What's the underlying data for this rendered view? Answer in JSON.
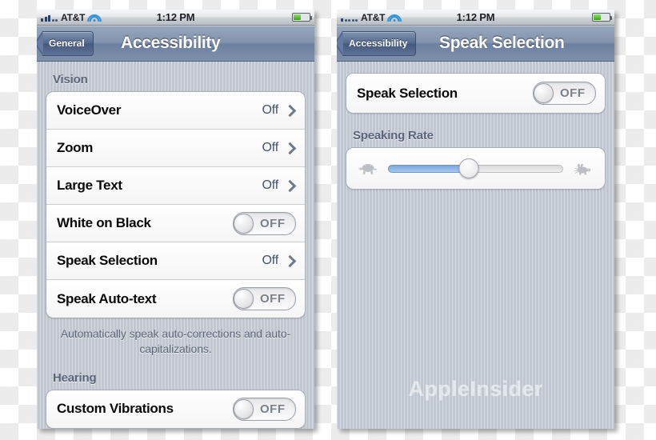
{
  "background": {
    "type": "transparency-checkerboard",
    "light": "#ffffff",
    "dark": "#ececec"
  },
  "left_phone": {
    "status_bar": {
      "carrier": "AT&T",
      "time": "1:12 PM",
      "signal_bars_filled": 3,
      "signal_bars_total": 5,
      "wifi": true,
      "battery_percent": 48
    },
    "nav": {
      "back_label": "General",
      "title": "Accessibility"
    },
    "sections": [
      {
        "header": "Vision",
        "rows": [
          {
            "label": "VoiceOver",
            "value": "Off",
            "control": "disclosure"
          },
          {
            "label": "Zoom",
            "value": "Off",
            "control": "disclosure"
          },
          {
            "label": "Large Text",
            "value": "Off",
            "control": "disclosure"
          },
          {
            "label": "White on Black",
            "value": "OFF",
            "control": "switch"
          },
          {
            "label": "Speak Selection",
            "value": "Off",
            "control": "disclosure"
          },
          {
            "label": "Speak Auto-text",
            "value": "OFF",
            "control": "switch"
          }
        ],
        "footnote": "Automatically speak auto-corrections and auto-capitalizations."
      },
      {
        "header": "Hearing",
        "rows": [
          {
            "label": "Custom Vibrations",
            "value": "OFF",
            "control": "switch"
          }
        ],
        "footnote": ""
      }
    ]
  },
  "right_phone": {
    "status_bar": {
      "carrier": "AT&T",
      "time": "1:12 PM",
      "signal_bars_filled": 1,
      "signal_bars_total": 5,
      "wifi": true,
      "battery_percent": 48
    },
    "nav": {
      "back_label": "Accessibility",
      "title": "Speak Selection"
    },
    "toggle_row": {
      "label": "Speak Selection",
      "value": "OFF"
    },
    "rate_section": {
      "header": "Speaking Rate",
      "slider": {
        "value_percent": 46,
        "min_icon": "tortoise-icon",
        "max_icon": "hare-icon"
      }
    },
    "watermark": "AppleInsider"
  }
}
